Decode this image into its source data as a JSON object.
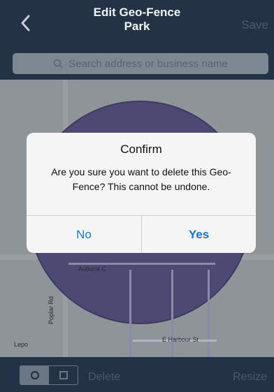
{
  "header": {
    "title_line1": "Edit Geo-Fence",
    "title_line2": "Park",
    "save_label": "Save",
    "back_icon": "chevron-left-icon"
  },
  "search": {
    "placeholder": "Search address or business name",
    "icon": "search-icon"
  },
  "map": {
    "street_labels": [
      "Auburst C",
      "Poplar Rd",
      "E Harbour St",
      "Lepo"
    ]
  },
  "dialog": {
    "title": "Confirm",
    "message": "Are you sure you want to delete this Geo-Fence? This cannot be undone.",
    "no_label": "No",
    "yes_label": "Yes",
    "accent_color": "#1677d8"
  },
  "toolbar": {
    "shape_circle_icon": "circle-shape-icon",
    "shape_square_icon": "square-shape-icon",
    "delete_label": "Delete",
    "resize_label": "Resize"
  },
  "colors": {
    "bar_background": "#233345",
    "disabled_text": "#4a5a6b",
    "fence_fill": "#4c4a73"
  }
}
